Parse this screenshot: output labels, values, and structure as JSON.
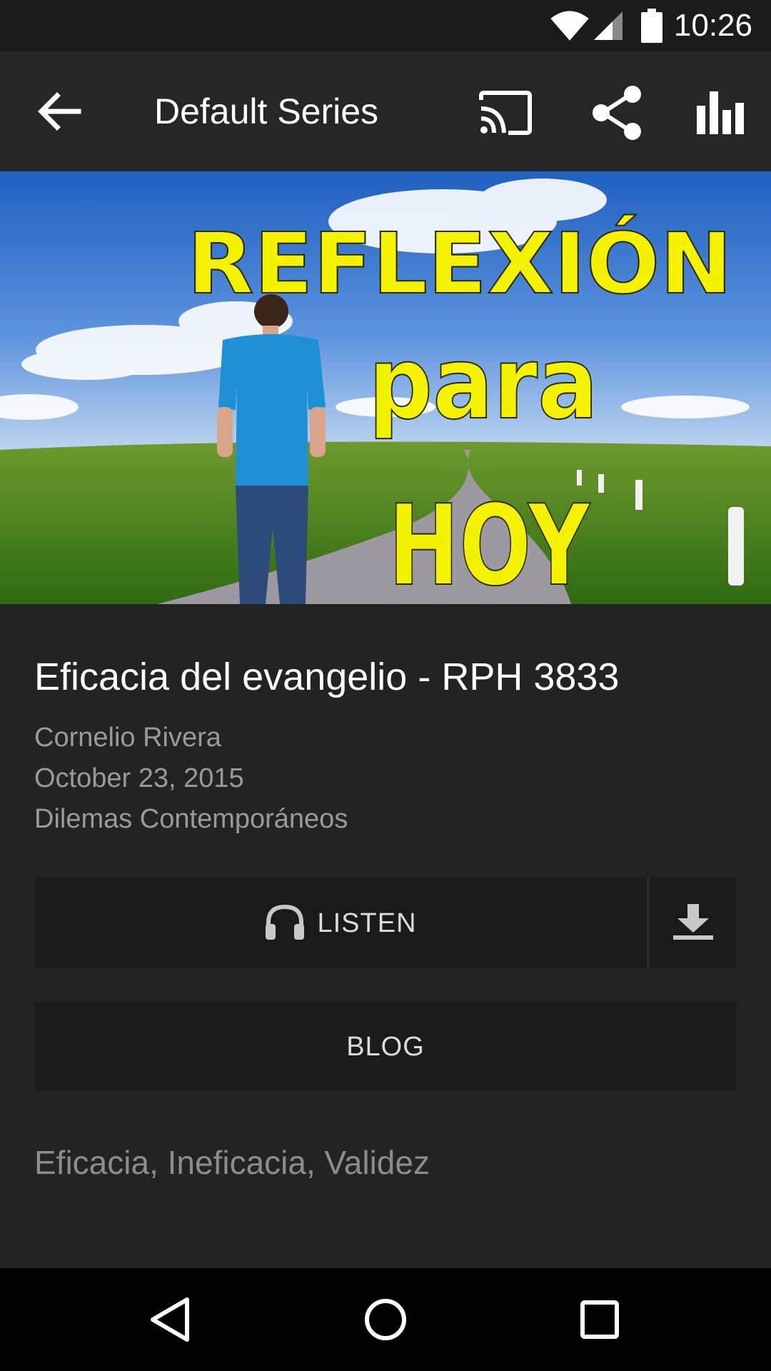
{
  "status_bar": {
    "time": "10:26",
    "icons": [
      "wifi-icon",
      "cell-signal-icon",
      "battery-icon"
    ]
  },
  "app_bar": {
    "title": "Default Series",
    "actions": [
      "cast-icon",
      "share-icon",
      "equalizer-icon"
    ]
  },
  "hero": {
    "line1": "REFLEXIÓN",
    "line2": "para",
    "line3": "HOY"
  },
  "episode": {
    "title": "Eficacia del evangelio - RPH 3833",
    "author": "Cornelio Rivera",
    "date": "October 23, 2015",
    "series": "Dilemas Contemporáneos"
  },
  "buttons": {
    "listen_label": "LISTEN",
    "blog_label": "BLOG"
  },
  "tags": "Eficacia, Ineficacia, Validez",
  "colors": {
    "background": "#232323",
    "app_bar": "#262626",
    "button_bg": "#1a1a1a",
    "hero_text": "#f5f200"
  }
}
